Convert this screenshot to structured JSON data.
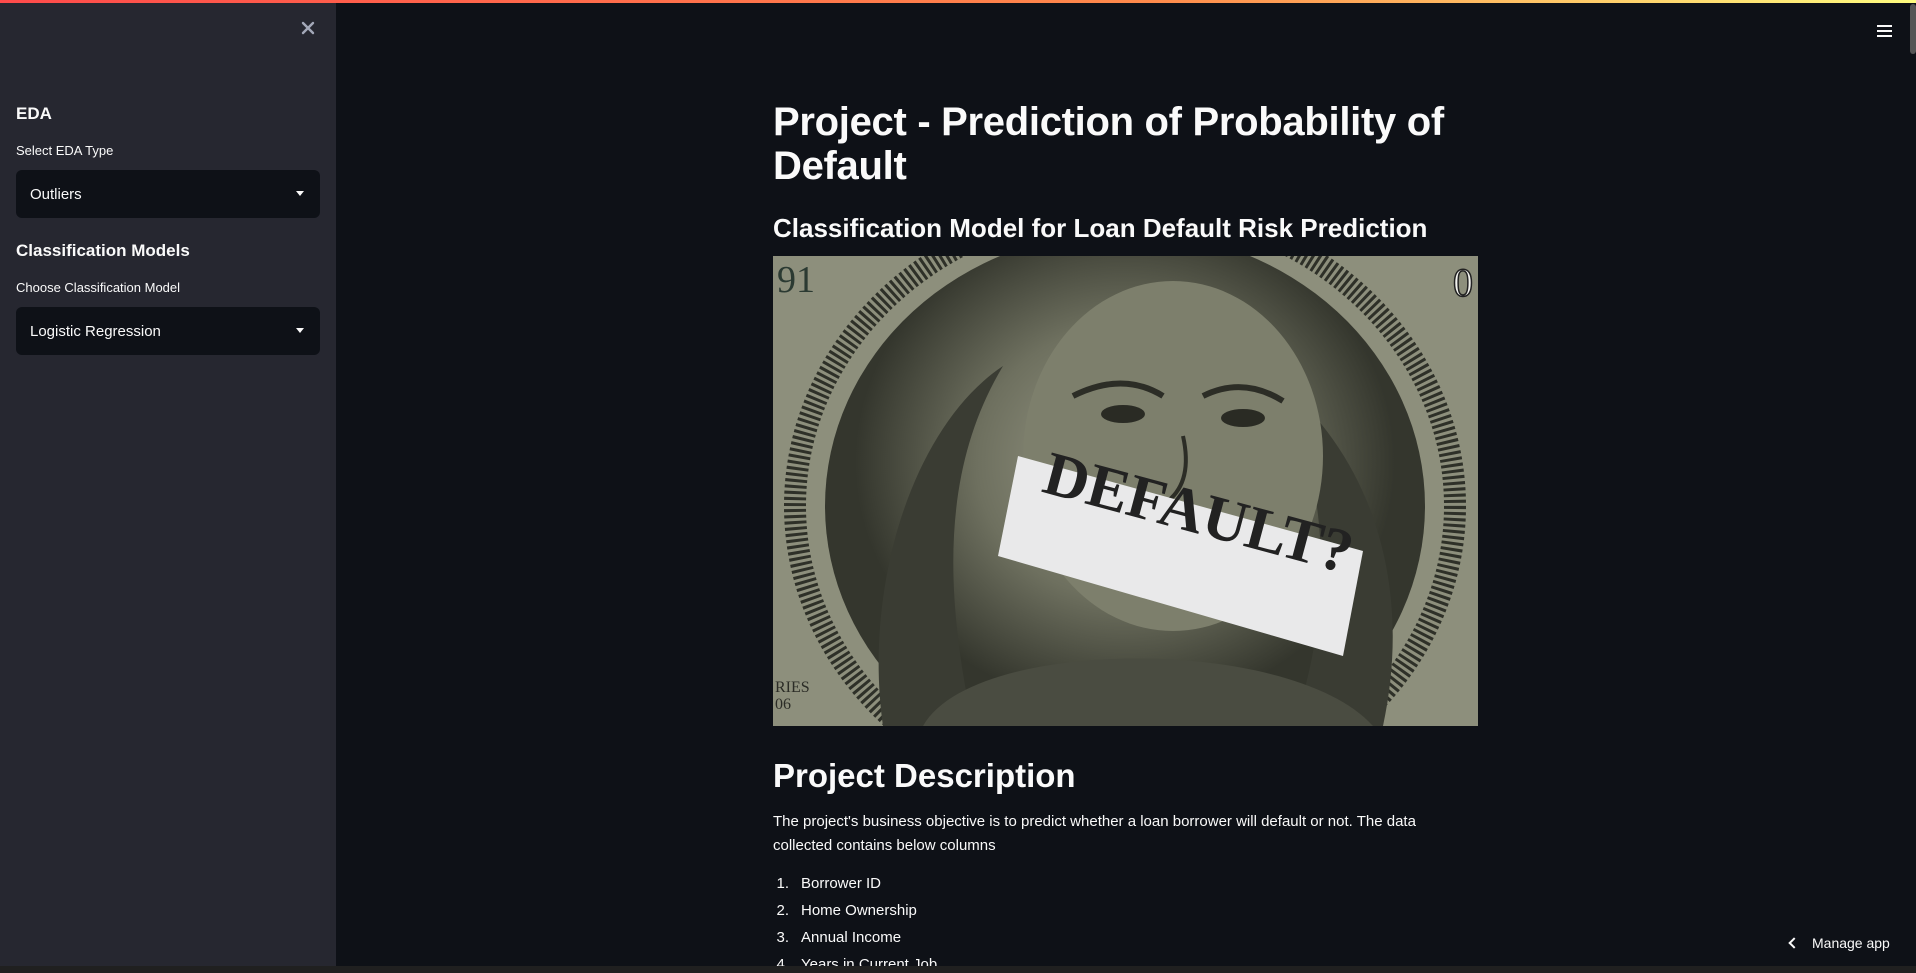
{
  "sidebar": {
    "eda_heading": "EDA",
    "eda_label": "Select EDA Type",
    "eda_value": "Outliers",
    "models_heading": "Classification Models",
    "models_label": "Choose Classification Model",
    "models_value": "Logistic Regression"
  },
  "main": {
    "title": "Project - Prediction of Probability of Default",
    "subtitle": "Classification Model for Loan Default Risk Prediction",
    "image": {
      "caption_text": "DEFAULT?",
      "corner_text_left_top": "91",
      "corner_text_bottom_left_1": "RIES",
      "corner_text_bottom_left_2": "06"
    },
    "section_title": "Project Description",
    "description": "The project's business objective is to predict whether a loan borrower will default or not. The data collected contains below columns",
    "columns": [
      {
        "num": "1.",
        "label": "Borrower ID"
      },
      {
        "num": "2.",
        "label": "Home Ownership"
      },
      {
        "num": "3.",
        "label": "Annual Income"
      },
      {
        "num": "4.",
        "label": "Years in Current Job"
      }
    ]
  },
  "footer": {
    "manage_app": "Manage app"
  },
  "icons": {
    "close": "close-icon",
    "menu": "hamburger-menu-icon",
    "chevron": "chevron-left-icon"
  },
  "colors": {
    "background": "#0e1117",
    "sidebar": "#262730",
    "text": "#fafafa",
    "accent": "#ff4b4b"
  }
}
